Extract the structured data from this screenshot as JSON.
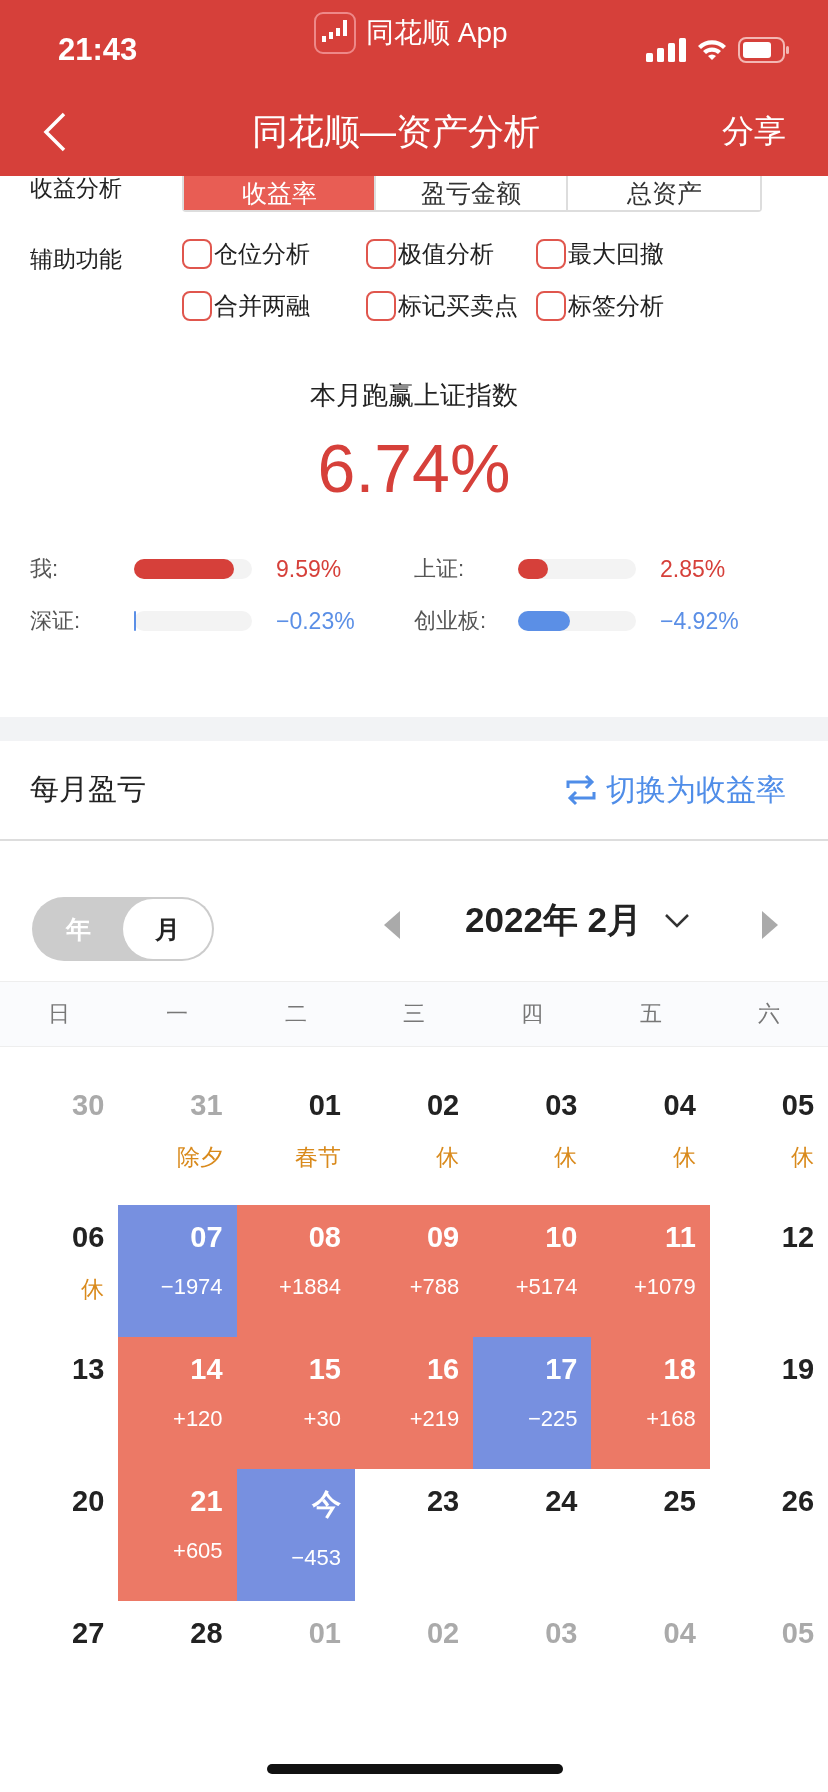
{
  "status_bar": {
    "time": "21:43",
    "app_label": "同花顺 App"
  },
  "nav": {
    "title": "同花顺—资产分析",
    "action": "分享"
  },
  "analysis": {
    "label": "收益分析",
    "tabs": [
      {
        "label": "收益率",
        "selected": true
      },
      {
        "label": "盈亏金额",
        "selected": false
      },
      {
        "label": "总资产",
        "selected": false
      }
    ]
  },
  "aux": {
    "label": "辅助功能",
    "options": [
      {
        "label": "仓位分析",
        "checked": false
      },
      {
        "label": "极值分析",
        "checked": false
      },
      {
        "label": "最大回撤",
        "checked": false
      },
      {
        "label": "合并两融",
        "checked": false
      },
      {
        "label": "标记买卖点",
        "checked": false
      },
      {
        "label": "标签分析",
        "checked": false
      }
    ]
  },
  "summary": {
    "caption": "本月跑赢上证指数",
    "value": "6.74%"
  },
  "comparisons": [
    {
      "name": "我:",
      "level": 0.85,
      "reading": "9.59%",
      "color": "#d6403a"
    },
    {
      "name": "上证:",
      "level": 0.25,
      "reading": "2.85%",
      "color": "#d6403a"
    },
    {
      "name": "深证:",
      "level": 0.01,
      "reading": "−0.23%",
      "color": "#5b8fe6"
    },
    {
      "name": "创业板:",
      "level": 0.44,
      "reading": "−4.92%",
      "color": "#5b8fe6"
    }
  ],
  "monthly": {
    "title": "每月盈亏",
    "switch_link": "切换为收益率"
  },
  "calendar": {
    "modes": [
      {
        "label": "年",
        "selected": false
      },
      {
        "label": "月",
        "selected": true
      }
    ],
    "month": "2022年 2月",
    "weekdays": [
      "日",
      "一",
      "二",
      "三",
      "四",
      "五",
      "六"
    ],
    "days": [
      {
        "day": "30",
        "muted": true
      },
      {
        "day": "31",
        "muted": true,
        "note": "除夕"
      },
      {
        "day": "01",
        "muted": false,
        "note": "春节"
      },
      {
        "day": "02",
        "muted": false,
        "note": "休"
      },
      {
        "day": "03",
        "muted": false,
        "note": "休"
      },
      {
        "day": "04",
        "muted": false,
        "note": "休"
      },
      {
        "day": "05",
        "muted": false,
        "note": "休"
      },
      {
        "day": "06",
        "muted": false,
        "note": "休"
      },
      {
        "day": "07",
        "muted": false,
        "color": "#7790e0",
        "amount": "−1974"
      },
      {
        "day": "08",
        "muted": false,
        "color": "#ec7966",
        "amount": "+1884"
      },
      {
        "day": "09",
        "muted": false,
        "color": "#ec7966",
        "amount": "+788"
      },
      {
        "day": "10",
        "muted": false,
        "color": "#ec7966",
        "amount": "+5174"
      },
      {
        "day": "11",
        "muted": false,
        "color": "#ec7966",
        "amount": "+1079"
      },
      {
        "day": "12",
        "muted": false
      },
      {
        "day": "13",
        "muted": false
      },
      {
        "day": "14",
        "muted": false,
        "color": "#ec7966",
        "amount": "+120"
      },
      {
        "day": "15",
        "muted": false,
        "color": "#ec7966",
        "amount": "+30"
      },
      {
        "day": "16",
        "muted": false,
        "color": "#ec7966",
        "amount": "+219"
      },
      {
        "day": "17",
        "muted": false,
        "color": "#7790e0",
        "amount": "−225"
      },
      {
        "day": "18",
        "muted": false,
        "color": "#ec7966",
        "amount": "+168"
      },
      {
        "day": "19",
        "muted": false
      },
      {
        "day": "20",
        "muted": false
      },
      {
        "day": "21",
        "muted": false,
        "color": "#ec7966",
        "amount": "+605"
      },
      {
        "day": "今",
        "muted": false,
        "color": "#7790e0",
        "amount": "−453"
      },
      {
        "day": "23",
        "muted": false
      },
      {
        "day": "24",
        "muted": false
      },
      {
        "day": "25",
        "muted": false
      },
      {
        "day": "26",
        "muted": false
      },
      {
        "day": "27",
        "muted": false
      },
      {
        "day": "28",
        "muted": false
      },
      {
        "day": "01",
        "muted": true
      },
      {
        "day": "02",
        "muted": true
      },
      {
        "day": "03",
        "muted": true
      },
      {
        "day": "04",
        "muted": true
      },
      {
        "day": "05",
        "muted": true
      }
    ]
  }
}
